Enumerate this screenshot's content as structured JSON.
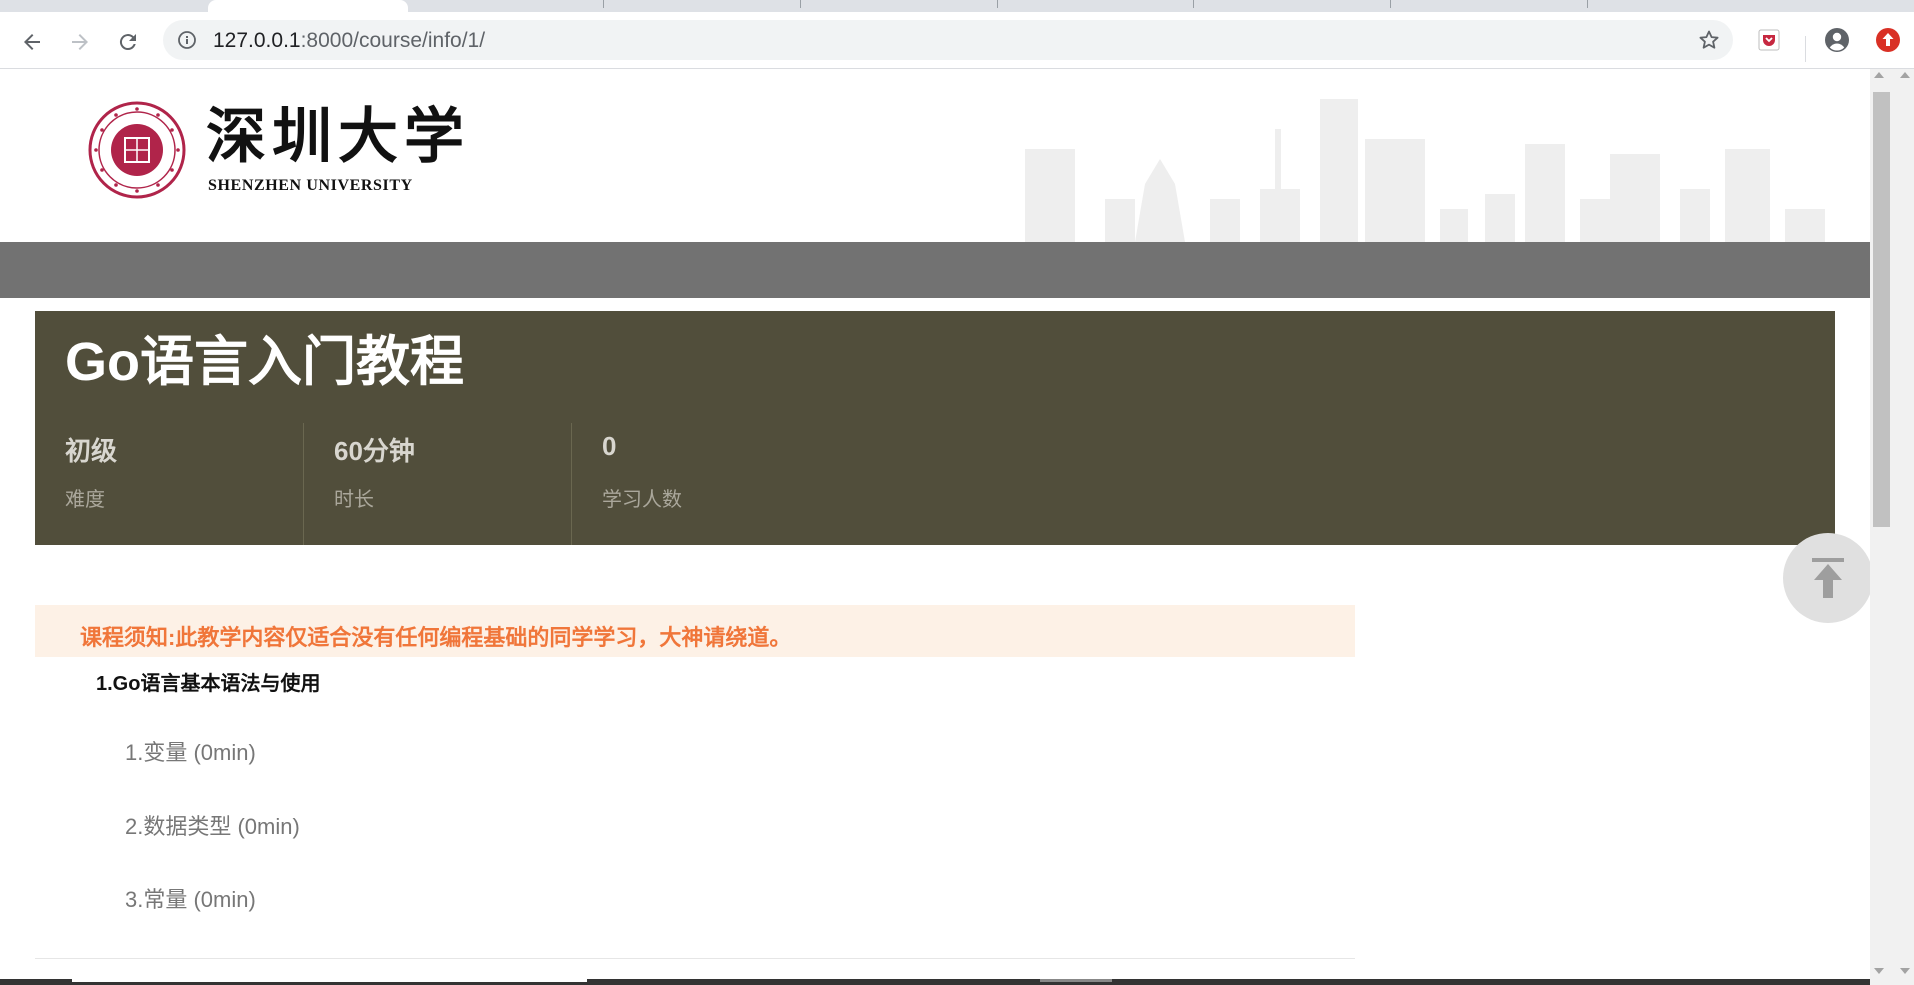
{
  "browser": {
    "url_host": "127.0.0.1",
    "url_path": ":8000/course/info/1/",
    "icons": [
      "back-icon",
      "forward-icon",
      "reload-icon",
      "site-info-icon",
      "bookmark-star-icon",
      "pocket-extension-icon",
      "profile-icon",
      "update-icon"
    ]
  },
  "header": {
    "logo_cn": "深圳大学",
    "logo_en": "SHENZHEN UNIVERSITY"
  },
  "course": {
    "title": "Go语言入门教程",
    "stats": [
      {
        "value": "初级",
        "label": "难度"
      },
      {
        "value": "60分钟",
        "label": "时长"
      },
      {
        "value": "0",
        "label": "学习人数"
      }
    ]
  },
  "notice": {
    "text": "课程须知:此教学内容仅适合没有任何编程基础的同学学习，大神请绕道。"
  },
  "chapters": [
    {
      "title": "1.Go语言基本语法与使用",
      "lessons": [
        {
          "label": "1.变量 (0min)"
        },
        {
          "label": "2.数据类型 (0min)"
        },
        {
          "label": "3.常量 (0min)"
        }
      ]
    }
  ],
  "colors": {
    "banner_bg": "#514e3b",
    "navbar_bg": "#727272",
    "notice_bg": "#fdf1e6",
    "notice_text": "#f0763a",
    "seal_red": "#b0244a"
  }
}
